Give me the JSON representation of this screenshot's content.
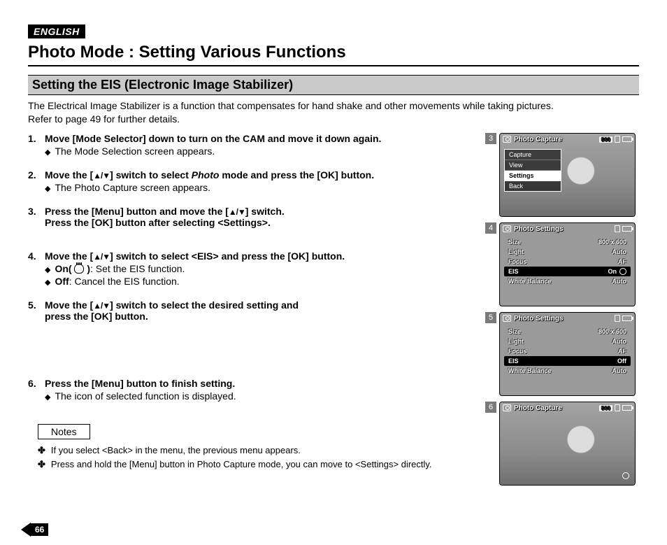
{
  "language_badge": "ENGLISH",
  "page_title": "Photo Mode : Setting Various Functions",
  "section_title": "Setting the EIS (Electronic Image Stabilizer)",
  "intro_line1": "The Electrical Image Stabilizer is a function that compensates for hand shake and other movements while taking pictures.",
  "intro_line2": "Refer to page 49 for further details.",
  "steps": [
    {
      "num": "1.",
      "head": "Move [Mode Selector] down to turn on the CAM and move it down again.",
      "bullets": [
        "The Mode Selection screen appears."
      ]
    },
    {
      "num": "2.",
      "head_pre": "Move the [",
      "head_mid": "] switch to select ",
      "head_italic": "Photo",
      "head_post": " mode and press the [OK] button.",
      "bullets": [
        "The Photo Capture screen appears."
      ]
    },
    {
      "num": "3.",
      "line1_pre": "Press the [Menu] button and move the [",
      "line1_post": "] switch.",
      "line2": "Press the [OK] button after selecting <Settings>."
    },
    {
      "num": "4.",
      "head_pre": "Move the [",
      "head_post": "] switch to select <EIS> and press the [OK] button.",
      "sub": [
        {
          "b": "On( ",
          "after": " )",
          "colon": ":",
          "text": " Set the EIS function.",
          "hand": true
        },
        {
          "b": "Off",
          "after": "",
          "colon": ":",
          "text": " Cancel the EIS function.",
          "hand": false
        }
      ]
    },
    {
      "num": "5.",
      "line1_pre": "Move the [",
      "line1_post": "] switch to select the desired setting and",
      "line2": "press the [OK] button."
    },
    {
      "num": "6.",
      "head": "Press the [Menu] button to finish setting.",
      "bullets": [
        "The icon of selected function is displayed."
      ]
    }
  ],
  "notes_label": "Notes",
  "notes": [
    "If you select <Back> in the menu, the previous menu appears.",
    "Press and hold the [Menu] button in Photo Capture mode, you can move to <Settings> directly."
  ],
  "screens": {
    "s3": {
      "num": "3",
      "title": "Photo Capture",
      "badge": "800",
      "menu": [
        "Capture",
        "View",
        "Settings",
        "Back"
      ],
      "selected": "Settings"
    },
    "s4": {
      "num": "4",
      "title": "Photo Settings",
      "rows": [
        {
          "k": "Size",
          "v": "800 x 600"
        },
        {
          "k": "Light",
          "v": "Auto"
        },
        {
          "k": "Focus",
          "v": "AF"
        },
        {
          "k": "EIS",
          "v": "On",
          "sel": true,
          "hand": true
        },
        {
          "k": "White Balance",
          "v": "Auto"
        }
      ]
    },
    "s5": {
      "num": "5",
      "title": "Photo Settings",
      "rows": [
        {
          "k": "Size",
          "v": "800 x 600"
        },
        {
          "k": "Light",
          "v": "Auto"
        },
        {
          "k": "Focus",
          "v": "AF"
        },
        {
          "k": "EIS",
          "v": "Off",
          "sel": true
        },
        {
          "k": "White Balance",
          "v": "Auto"
        }
      ]
    },
    "s6": {
      "num": "6",
      "title": "Photo Capture",
      "badge": "800"
    }
  },
  "page_number": "66"
}
